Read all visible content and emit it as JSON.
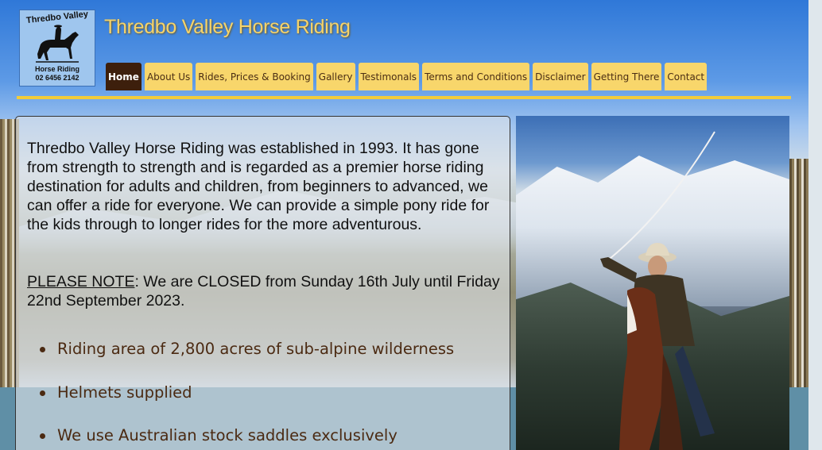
{
  "logo": {
    "top_text": "Thredbo Valley",
    "sub_text": "Horse Riding",
    "phone": "02 6456 2142"
  },
  "site_title": "Thredbo Valley Horse Riding",
  "nav": {
    "items": [
      {
        "label": "Home",
        "active": true
      },
      {
        "label": "About Us",
        "active": false
      },
      {
        "label": "Rides, Prices & Booking",
        "active": false
      },
      {
        "label": "Gallery",
        "active": false
      },
      {
        "label": "Testimonals",
        "active": false
      },
      {
        "label": "Terms and Conditions",
        "active": false
      },
      {
        "label": "Disclaimer",
        "active": false
      },
      {
        "label": "Getting There",
        "active": false
      },
      {
        "label": "Contact",
        "active": false
      }
    ]
  },
  "content": {
    "intro": "Thredbo Valley Horse Riding was established in 1993. It has gone from strength to strength and is regarded as a premier horse riding destination for adults and children, from beginners to advanced, we can offer a ride for everyone. We can provide a simple pony ride for the kids through to longer rides for the more adventurous.",
    "notice_label": "PLEASE NOTE",
    "notice_text": ": We are CLOSED from Sunday 16th July until Friday 22nd September 2023.",
    "features": [
      "Riding area of 2,800 acres of sub-alpine wilderness",
      "Helmets supplied",
      "We use Australian stock saddles exclusively"
    ]
  },
  "colors": {
    "title": "#f5d36a",
    "nav_bg": "#f8d66b",
    "nav_active_bg": "#3d1f0c",
    "rule": "#f2cc3a",
    "feature_text": "#4b2a12"
  },
  "icons": {
    "logo": "horse-rider-silhouette",
    "photo": "rider-on-horse-with-whip-in-snowy-mountains"
  }
}
